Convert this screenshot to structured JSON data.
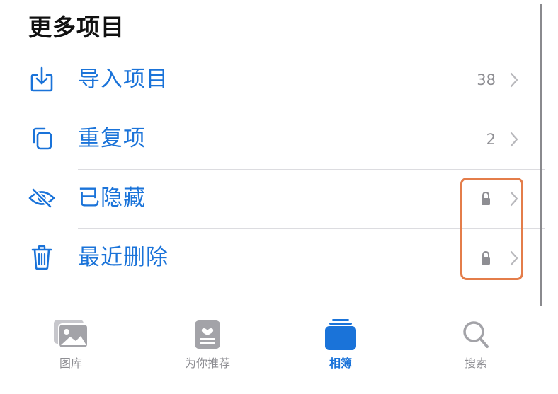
{
  "section": {
    "title": "更多项目"
  },
  "items": [
    {
      "label": "导入项目",
      "count": "38",
      "icon": "import-icon",
      "locked": false
    },
    {
      "label": "重复项",
      "count": "2",
      "icon": "duplicate-icon",
      "locked": false
    },
    {
      "label": "已隐藏",
      "count": "",
      "icon": "eye-slash-icon",
      "locked": true
    },
    {
      "label": "最近删除",
      "count": "",
      "icon": "trash-icon",
      "locked": true
    }
  ],
  "tabs": [
    {
      "label": "图库",
      "icon": "photo-library-icon",
      "active": false
    },
    {
      "label": "为你推荐",
      "icon": "for-you-icon",
      "active": false
    },
    {
      "label": "相簿",
      "icon": "albums-icon",
      "active": true
    },
    {
      "label": "搜索",
      "icon": "search-icon",
      "active": false
    }
  ],
  "colors": {
    "accent": "#1a73d9",
    "secondary_text": "#8e8e93",
    "highlight": "#e47d4a",
    "divider": "#dcdce0"
  }
}
